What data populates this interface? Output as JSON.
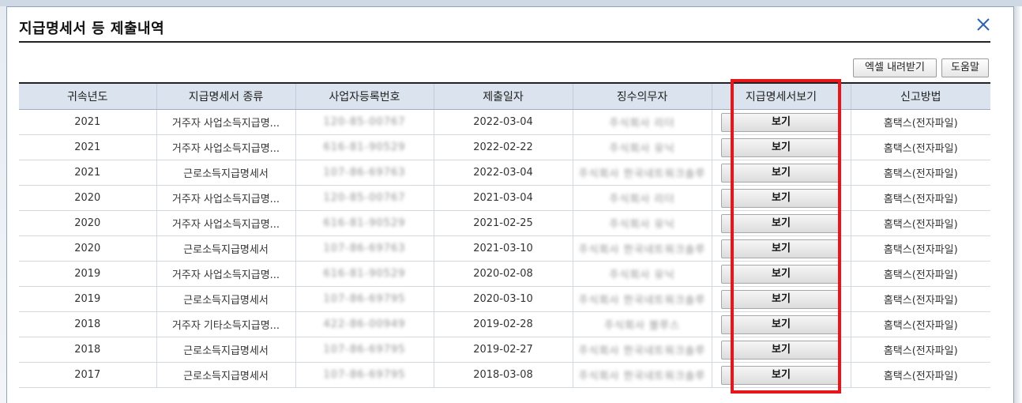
{
  "dialog": {
    "title": "지급명세서 등 제출내역",
    "close_icon": "close-x-icon",
    "accent_color": "#2a64b8"
  },
  "toolbar": {
    "excel_label": "엑셀 내려받기",
    "help_label": "도움말"
  },
  "table": {
    "headers": [
      "귀속년도",
      "지급명세서 종류",
      "사업자등록번호",
      "제출일자",
      "징수의무자",
      "지급명세서보기",
      "신고방법"
    ],
    "rows": [
      {
        "year": "2021",
        "type": "거주자 사업소득지급명...",
        "bizno": "120-85-00767",
        "date": "2022-03-04",
        "payer": "주식회사 리더",
        "view": "보기",
        "method": "홈택스(전자파일)"
      },
      {
        "year": "2021",
        "type": "거주자 사업소득지급명...",
        "bizno": "616-81-90529",
        "date": "2022-02-22",
        "payer": "주식회사 유닉",
        "view": "보기",
        "method": "홈택스(전자파일)"
      },
      {
        "year": "2021",
        "type": "근로소득지급명세서",
        "bizno": "107-86-69763",
        "date": "2022-03-04",
        "payer": "주식회사 한국네트워크솔루",
        "view": "보기",
        "method": "홈택스(전자파일)"
      },
      {
        "year": "2020",
        "type": "거주자 사업소득지급명...",
        "bizno": "120-85-00767",
        "date": "2021-03-04",
        "payer": "주식회사 리더",
        "view": "보기",
        "method": "홈택스(전자파일)"
      },
      {
        "year": "2020",
        "type": "거주자 사업소득지급명...",
        "bizno": "616-81-90529",
        "date": "2021-02-25",
        "payer": "주식회사 유닉",
        "view": "보기",
        "method": "홈택스(전자파일)"
      },
      {
        "year": "2020",
        "type": "근로소득지급명세서",
        "bizno": "107-86-69763",
        "date": "2021-03-10",
        "payer": "주식회사 한국네트워크솔루",
        "view": "보기",
        "method": "홈택스(전자파일)"
      },
      {
        "year": "2019",
        "type": "거주자 사업소득지급명...",
        "bizno": "616-81-90529",
        "date": "2020-02-08",
        "payer": "주식회사 유닉",
        "view": "보기",
        "method": "홈택스(전자파일)"
      },
      {
        "year": "2019",
        "type": "근로소득지급명세서",
        "bizno": "107-86-69795",
        "date": "2020-03-10",
        "payer": "주식회사 한국네트워크솔루",
        "view": "보기",
        "method": "홈택스(전자파일)"
      },
      {
        "year": "2018",
        "type": "거주자 기타소득지급명...",
        "bizno": "422-86-00949",
        "date": "2019-02-28",
        "payer": "주식회사 블루스",
        "view": "보기",
        "method": "홈택스(전자파일)"
      },
      {
        "year": "2018",
        "type": "근로소득지급명세서",
        "bizno": "107-86-69795",
        "date": "2019-02-27",
        "payer": "주식회사 한국네트워크솔루",
        "view": "보기",
        "method": "홈택스(전자파일)"
      },
      {
        "year": "2017",
        "type": "근로소득지급명세서",
        "bizno": "107-86-69795",
        "date": "2018-03-08",
        "payer": "주식회사 한국네트워크솔루",
        "view": "보기",
        "method": "홈택스(전자파일)"
      }
    ]
  },
  "highlight": {
    "color": "#e8161b"
  }
}
